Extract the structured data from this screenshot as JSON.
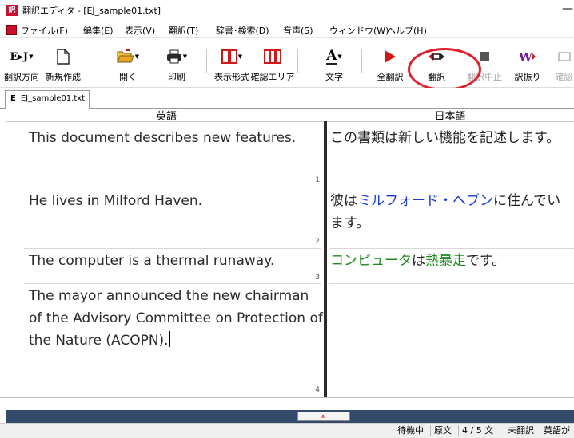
{
  "window": {
    "title": "翻訳エディタ - [EJ_sample01.txt]",
    "app_icon_glyph": "訳",
    "minimize_glyph": "—"
  },
  "menu": [
    "ファイル(F)",
    "編集(E)",
    "表示(V)",
    "翻訳(T)",
    "辞書･検索(D)",
    "音声(S)",
    "ウィンドウ(W)",
    "ヘルプ(H)"
  ],
  "toolbar": {
    "direction": {
      "icon_text": "E▸J",
      "label": "翻訳方向"
    },
    "new": {
      "label": "新規作成"
    },
    "open": {
      "label": "開く"
    },
    "print": {
      "label": "印刷"
    },
    "display_format": {
      "label": "表示形式"
    },
    "confirm_area": {
      "label": "確認エリア"
    },
    "text_style": {
      "icon_text": "A",
      "label": "文字"
    },
    "translate_all": {
      "label": "全翻訳"
    },
    "translate": {
      "label": "翻訳"
    },
    "stop_translation": {
      "label": "翻訳中止"
    },
    "assign_translation": {
      "label": "訳振り"
    },
    "confirm": {
      "label": "確認"
    }
  },
  "tab": {
    "label": "EJ_sample01.txt"
  },
  "columns": {
    "source": "英語",
    "target": "日本語"
  },
  "rows": [
    {
      "source": "This document describes new features.",
      "target": "この書類は新しい機能を記述します。",
      "number": "1"
    },
    {
      "source": "He lives in Milford Haven.",
      "target": [
        "彼は",
        "ミルフォード・ヘブン",
        "に住んでいます。"
      ],
      "number": "2"
    },
    {
      "source": "The computer is a thermal runaway.",
      "target": [
        "コンピュータ",
        "は",
        "熱暴走",
        "です。"
      ],
      "number": "3"
    },
    {
      "source": "The mayor announced the new chairman of the Advisory Committee on Protection of the Nature (ACOPN).",
      "target": "",
      "number": "4"
    }
  ],
  "splitter": {
    "glyph": "»"
  },
  "status": [
    "待機中",
    "原文",
    "4 / 5 文",
    "未翻訳",
    "英語が"
  ],
  "colors": {
    "highlight": "#e0202a",
    "term_blue": "#1a3bd8",
    "term_green": "#1f8a1f",
    "bottom_bar": "#344a6a"
  }
}
